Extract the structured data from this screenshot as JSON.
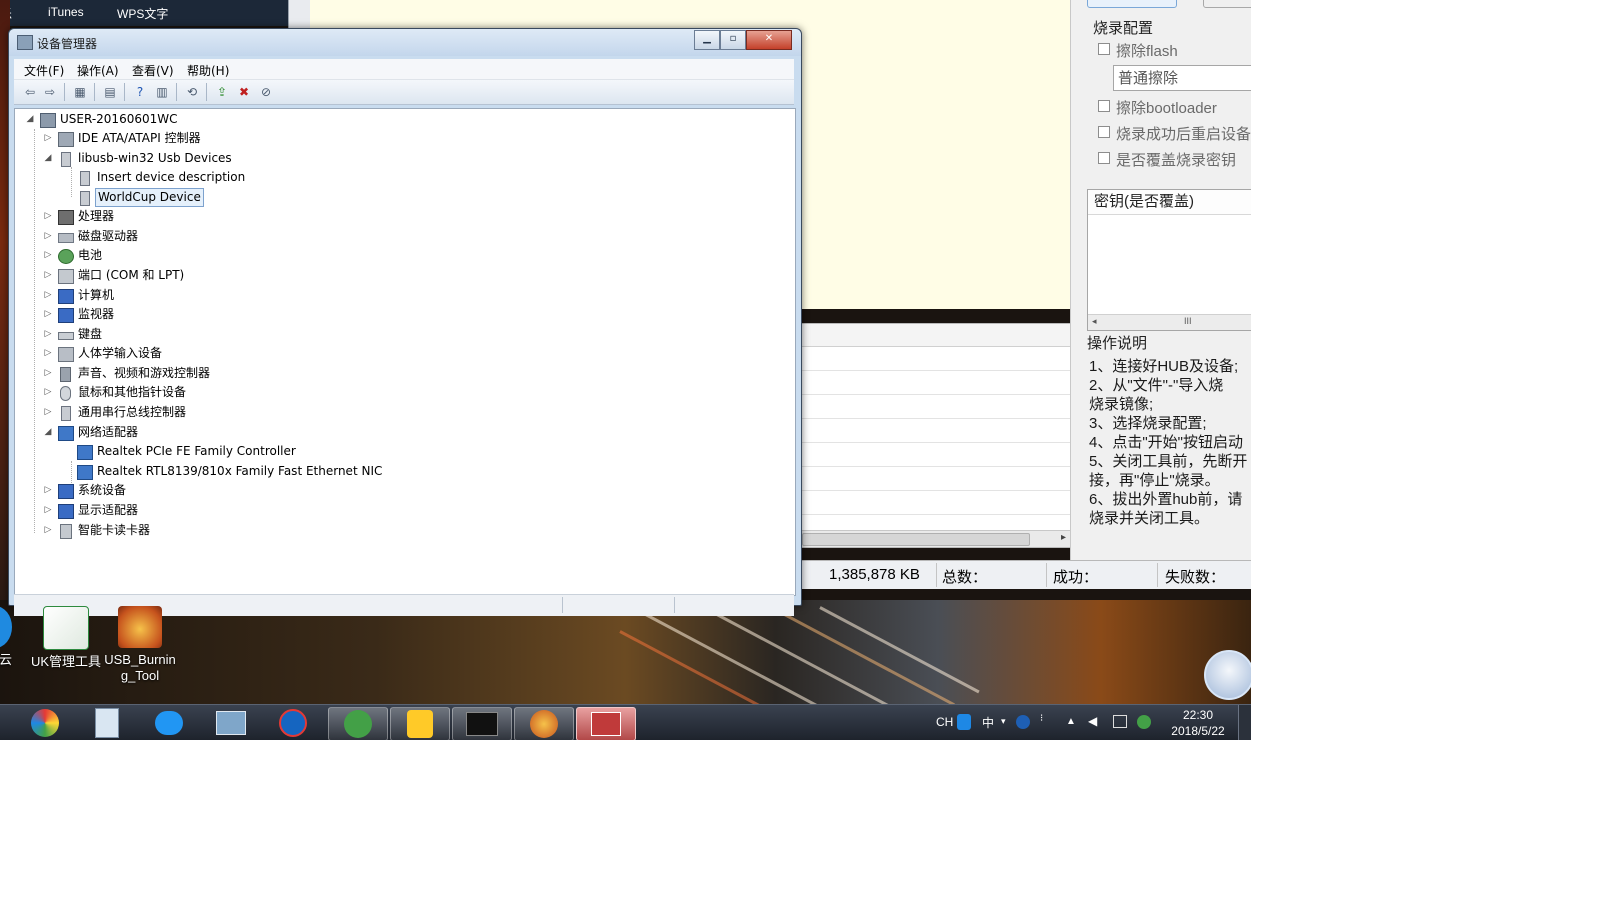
{
  "desktop": {
    "top_labels": [
      "乐",
      "iTunes",
      "WPS文字"
    ],
    "icons": [
      {
        "label": "UK管理工具"
      },
      {
        "label": "USB_Burning_Tool"
      },
      {
        "label": "云"
      }
    ]
  },
  "device_manager": {
    "title": "设备管理器",
    "menu": [
      "文件(F)",
      "操作(A)",
      "查看(V)",
      "帮助(H)"
    ],
    "tree": {
      "root": "USER-20160601WC",
      "items": [
        {
          "label": "IDE ATA/ATAPI 控制器",
          "expanded": false
        },
        {
          "label": "libusb-win32 Usb Devices",
          "expanded": true,
          "children": [
            "Insert device description",
            "WorldCup Device"
          ]
        },
        {
          "label": "处理器",
          "expanded": false
        },
        {
          "label": "磁盘驱动器",
          "expanded": false
        },
        {
          "label": "电池",
          "expanded": false
        },
        {
          "label": "端口 (COM 和 LPT)",
          "expanded": false
        },
        {
          "label": "计算机",
          "expanded": false
        },
        {
          "label": "监视器",
          "expanded": false
        },
        {
          "label": "键盘",
          "expanded": false
        },
        {
          "label": "人体学输入设备",
          "expanded": false
        },
        {
          "label": "声音、视频和游戏控制器",
          "expanded": false
        },
        {
          "label": "鼠标和其他指针设备",
          "expanded": false
        },
        {
          "label": "通用串行总线控制器",
          "expanded": false
        },
        {
          "label": "网络适配器",
          "expanded": true,
          "children": [
            "Realtek PCIe FE Family Controller",
            "Realtek RTL8139/810x Family Fast Ethernet NIC"
          ]
        },
        {
          "label": "系统设备",
          "expanded": false
        },
        {
          "label": "显示适配器",
          "expanded": false
        },
        {
          "label": "智能卡读卡器",
          "expanded": false
        }
      ],
      "selected": "WorldCup Device"
    }
  },
  "burning_tool": {
    "burn_config_title": "烧录配置",
    "erase_flash": "擦除flash",
    "erase_mode": "普通擦除",
    "erase_bootloader": "擦除bootloader",
    "reboot_after": "烧录成功后重启设备",
    "overwrite_key": "是否覆盖烧录密钥",
    "key_header": "密钥(是否覆盖)",
    "instructions_title": "操作说明",
    "instructions": [
      "1、连接好HUB及设备;",
      "2、从\"文件\"-\"导入烧",
      "烧录镜像;",
      "3、选择烧录配置;",
      "4、点击\"开始\"按钮启动",
      "5、关闭工具前，先断开",
      "接，再\"停止\"烧录。",
      "6、拔出外置hub前，请",
      "烧录并关闭工具。"
    ],
    "status": {
      "size": "1,385,878 KB",
      "total_label": "总数：",
      "success_label": "成功：",
      "fail_label": "失败数："
    }
  },
  "taskbar": {
    "tray": {
      "lang": "CH",
      "ime": "中"
    },
    "clock_time": "22:30",
    "clock_date": "2018/5/22"
  }
}
